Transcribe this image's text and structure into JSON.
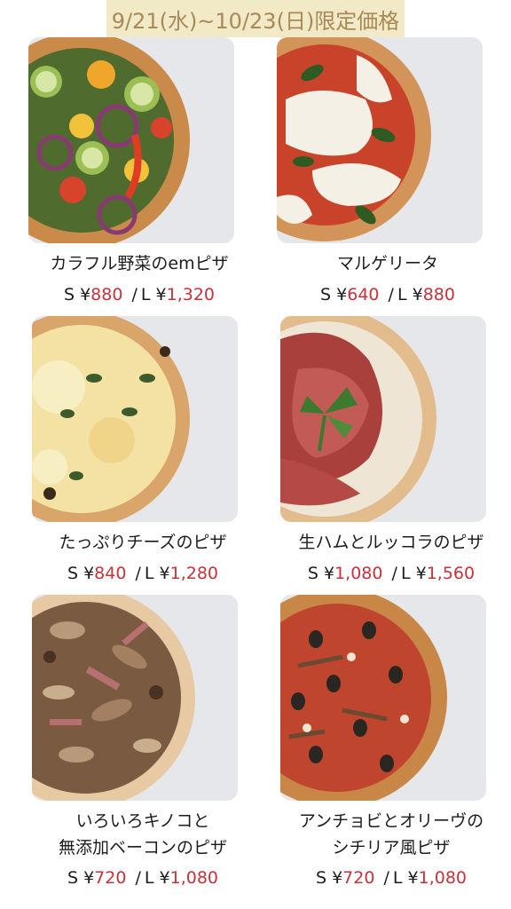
{
  "banner": {
    "text": "9/21(水)~10/23(日)限定価格"
  },
  "currency": "¥",
  "slash": "/",
  "size_s": "S",
  "size_l": "L",
  "items": [
    {
      "name": "カラフル野菜のemピザ",
      "name2": "",
      "price_s": "880",
      "price_l": "1,320",
      "crust": "#c98a4a",
      "topping": "#5b7a35",
      "accent": "#e05a2a"
    },
    {
      "name": "マルゲリータ",
      "name2": "",
      "price_s": "640",
      "price_l": "880",
      "crust": "#d3945a",
      "topping": "#f1eee4",
      "accent": "#c9432b"
    },
    {
      "name": "たっぷりチーズのピザ",
      "name2": "",
      "price_s": "840",
      "price_l": "1,280",
      "crust": "#d9a56a",
      "topping": "#f3e2a4",
      "accent": "#3d5a2a"
    },
    {
      "name": "生ハムとルッコラのピザ",
      "name2": "",
      "price_s": "1,080",
      "price_l": "1,560",
      "crust": "#d8a774",
      "topping": "#b0443f",
      "accent": "#3b7a2f"
    },
    {
      "name": "いろいろキノコと",
      "name2": "無添加ベーコンのピザ",
      "price_s": "720",
      "price_l": "1,080",
      "crust": "#d9b184",
      "topping": "#8a6a4c",
      "accent": "#6b4a32"
    },
    {
      "name": "アンチョビとオリーヴの",
      "name2": "シチリア風ピザ",
      "price_s": "720",
      "price_l": "1,080",
      "crust": "#c88746",
      "topping": "#c0452e",
      "accent": "#2a2622"
    }
  ]
}
